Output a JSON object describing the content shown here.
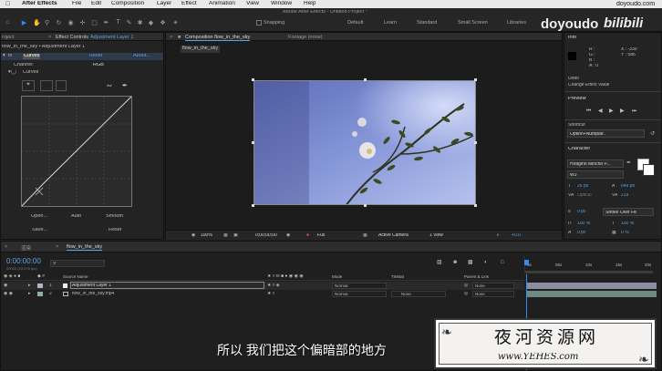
{
  "menubar": {
    "app": "After Effects",
    "items": [
      "File",
      "Edit",
      "Composition",
      "Layer",
      "Effect",
      "Animation",
      "View",
      "Window",
      "Help"
    ],
    "watermark": "doyoudo.com"
  },
  "toolbar": {
    "title": "Adobe After Effects - Untitled Project *",
    "snapping": "Snapping",
    "workspaces": [
      "Default",
      "Learn",
      "Standard",
      "Small Screen",
      "Libraries"
    ],
    "brand": "doyoudo",
    "brand2": "bilibili"
  },
  "project_tab": "roject",
  "effect_controls": {
    "tab_prefix": "Effect Controls ",
    "tab_layer": "Adjustment Layer 1",
    "breadcrumb": "flow_in_the_sky • Adjustment Layer 1",
    "fx_label": "fx",
    "effect_name": "Curves",
    "reset": "Reset",
    "about": "About...",
    "channel_label": "Channel:",
    "channel_value": "RGB",
    "curves_label": "Curves",
    "buttons": [
      "Open...",
      "Auto",
      "Smooth",
      "Save...",
      "Reset"
    ]
  },
  "composition": {
    "tab": "Composition flow_in_the_sky",
    "footage_tab": "Footage (none)",
    "subtab": "flow_in_the_sky",
    "zoom": "100%",
    "timecode": "0;00;00;00",
    "resolution": "Full",
    "camera": "Active Camera",
    "views": "1 View",
    "exposure": "+0.0"
  },
  "info": {
    "title": "Info",
    "r": "R :",
    "g": "G :",
    "b": "B :",
    "a": "A : 0",
    "x": "X : -330",
    "y": "Y : 586",
    "undo_title": "Undo",
    "undo_action": "Change Effect Value"
  },
  "preview": {
    "title": "Preview"
  },
  "shortcut": {
    "label": "Shortcut",
    "value": "Option+Numpad ."
  },
  "character": {
    "title": "Character",
    "font": "Hiragino Mincho P...",
    "weight": "W3",
    "size": "26 px",
    "leading": "649 px",
    "kerning": "Optical",
    "tracking": "219",
    "stroke_width": "0 px",
    "stroke_type": "Stroke Over Fill",
    "vscale": "100 %",
    "hscale": "100 %",
    "baseline": "0 px",
    "tsume": "0 %"
  },
  "timeline": {
    "tab_render": "渲染",
    "tab_comp": "flow_in_the_sky",
    "timecode": "0:00:00:00",
    "timecode_sub": "00000 (23.976 fps)",
    "col_source": "Source Name",
    "col_mode": "Mode",
    "col_trkmat": "TrkMat",
    "col_parent": "Parent & Link",
    "ruler": [
      "0s",
      "05s",
      "10s",
      "15s",
      "20s"
    ],
    "layers": [
      {
        "num": "1",
        "name": "Adjustment Layer 1",
        "mode": "Normal",
        "trkmat": "",
        "parent": "None"
      },
      {
        "num": "2",
        "name": "flow_in_the_sky.mp4",
        "mode": "Normal",
        "trkmat": "None",
        "parent": "None"
      }
    ]
  },
  "subtitle": "所以 我们把这个偏暗部的地方",
  "site_logo": {
    "title": "夜河资源网",
    "url": "www.YEHES.com"
  }
}
